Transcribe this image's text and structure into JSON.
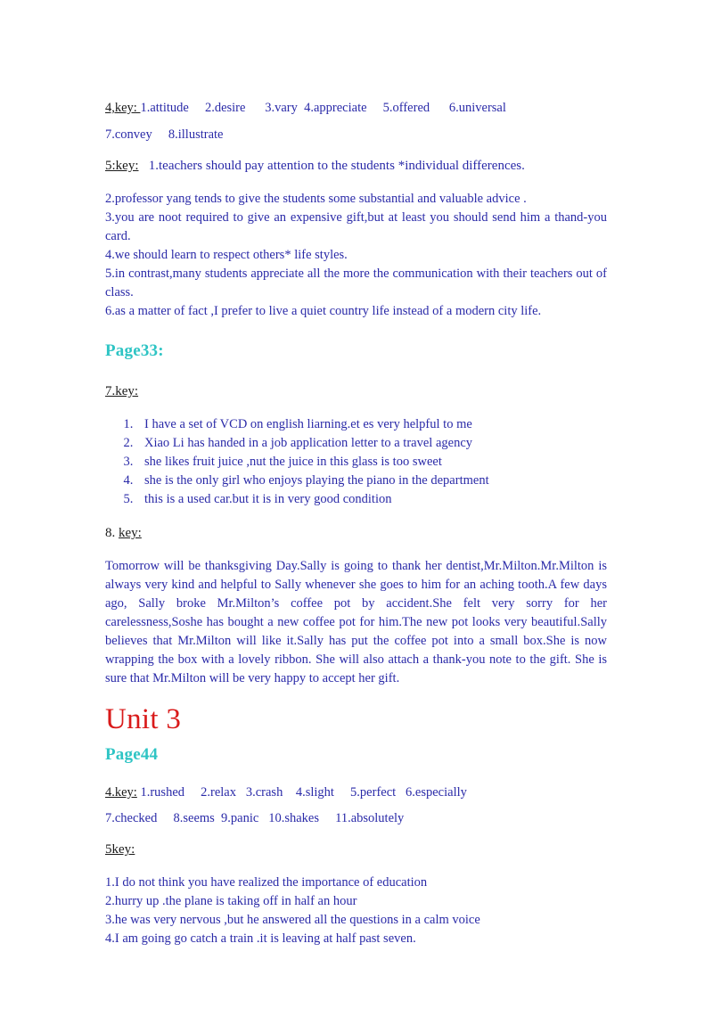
{
  "colors": {
    "body_text": "#2a2aa8",
    "label_text": "#1a1a1a",
    "page_heading": "#2ec4c4",
    "unit_heading": "#d91a1a",
    "background": "#ffffff"
  },
  "sections": {
    "key4_top": {
      "label": "4,key: ",
      "line1": "1.attitude     2.desire      3.vary  4.appreciate     5.offered      6.universal",
      "line2": "7.convey     8.illustrate"
    },
    "key5_top": {
      "label": "5:key:",
      "item1": "   1.teachers should pay attention to the students *individual differences.",
      "item2": "2.professor yang tends to give the students some substantial and valuable advice .",
      "item3": "3.you are noot required to give an expensive gift,but at least you should send him a thand-you card.",
      "item4": "4.we should learn to respect others* life styles.",
      "item5": "5.in contrast,many students appreciate all the more the communication with their teachers out of class.",
      "item6": "6.as a matter of fact ,I prefer to live a quiet country life instead of a modern city life."
    },
    "page33_heading": "Page33:",
    "key7": {
      "label": "7.key:",
      "items": [
        "I have a set of VCD on english liarning.et es very helpful to me",
        "Xiao Li has handed in a job application letter to a travel agency",
        "she likes fruit juice ,nut the juice in this glass is too sweet",
        "she is the only girl who enjoys playing the piano in the department",
        "this is a used car.but it is in very good condition"
      ]
    },
    "key8": {
      "number": "8. ",
      "label": "key:",
      "paragraph": "Tomorrow will be thanksgiving Day.Sally is going to thank her dentist,Mr.Milton.Mr.Milton is always very kind and helpful to Sally whenever she goes to him for an aching tooth.A few days ago, Sally broke Mr.Milton’s coffee pot by accident.She felt very sorry for her carelessness,Soshe has bought a new coffee pot for him.The new pot looks very beautiful.Sally believes that Mr.Milton will like it.Sally has put the coffee pot into a small box.She is now wrapping the box with a lovely ribbon. She will also attach a thank-you note to the gift. She is sure that Mr.Milton will be very happy to accept her gift."
    },
    "unit3_heading": "Unit 3",
    "page44_heading": "Page44",
    "key4_bottom": {
      "label": "4.key:",
      "line1": " 1.rushed     2.relax   3.crash    4.slight     5.perfect   6.especially",
      "line2": "7.checked     8.seems  9.panic   10.shakes     11.absolutely"
    },
    "key5_bottom": {
      "label": "5key:",
      "item1": "1.I do not think you have realized the importance of education",
      "item2": "2.hurry up .the plane is taking off in half an hour",
      "item3": "3.he was very nervous ,but he answered all the questions in a calm voice",
      "item4": "4.I am going go catch a train .it is leaving at half past seven."
    }
  }
}
